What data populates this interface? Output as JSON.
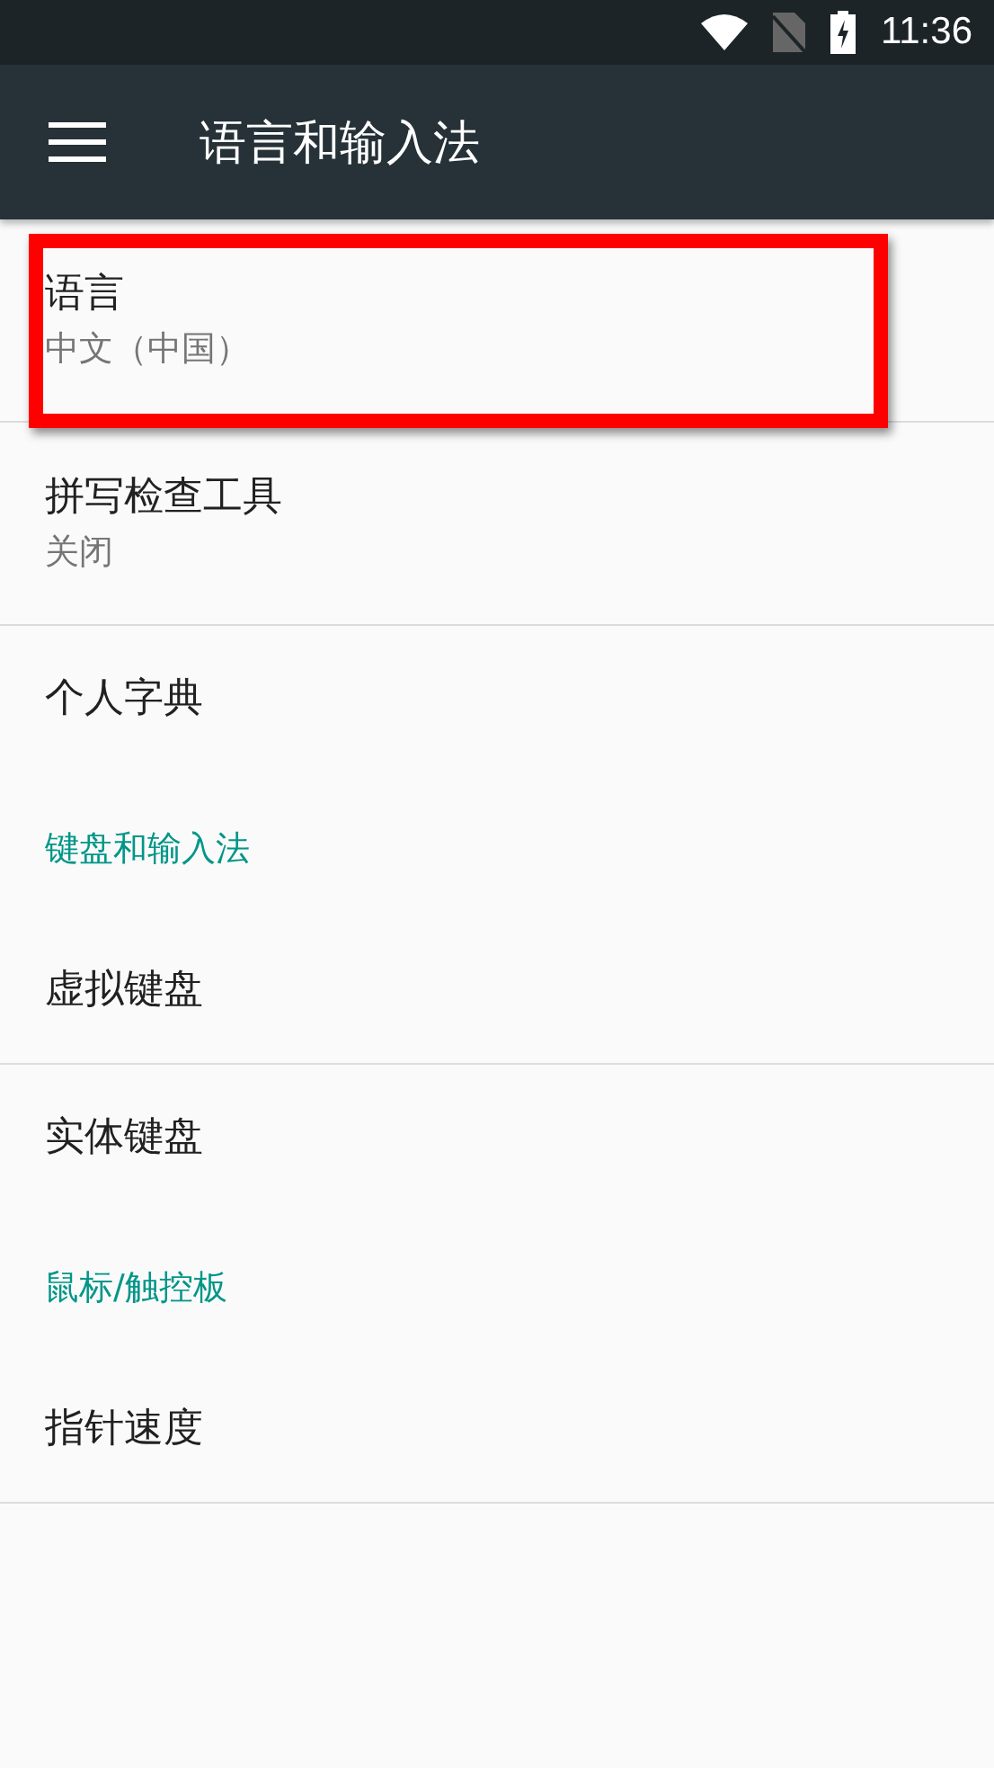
{
  "status_bar": {
    "time": "11:36"
  },
  "toolbar": {
    "title": "语言和输入法"
  },
  "items": [
    {
      "kind": "item",
      "title": "语言",
      "summary": "中文（中国）",
      "divider": true,
      "highlighted": true
    },
    {
      "kind": "item",
      "title": "拼写检查工具",
      "summary": "关闭",
      "divider": true,
      "highlighted": false
    },
    {
      "kind": "item",
      "title": "个人字典",
      "divider": false,
      "highlighted": false
    },
    {
      "kind": "category",
      "title": "键盘和输入法"
    },
    {
      "kind": "item",
      "title": "虚拟键盘",
      "divider": true,
      "highlighted": false
    },
    {
      "kind": "item",
      "title": "实体键盘",
      "divider": false,
      "highlighted": false
    },
    {
      "kind": "category",
      "title": "鼠标/触控板"
    },
    {
      "kind": "item",
      "title": "指针速度",
      "divider": true,
      "highlighted": false
    }
  ]
}
